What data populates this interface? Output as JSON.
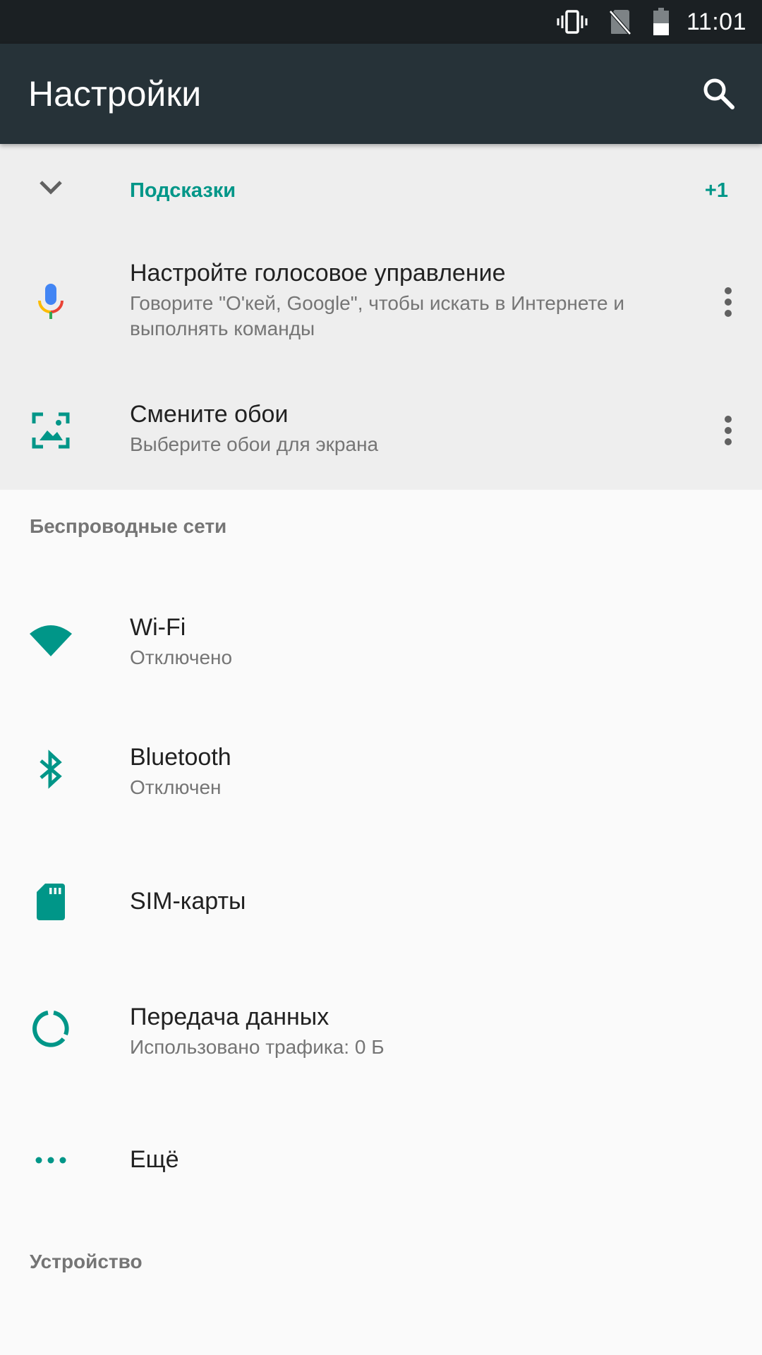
{
  "status_bar": {
    "time": "11:01"
  },
  "app_bar": {
    "title": "Настройки"
  },
  "suggestions": {
    "header": "Подсказки",
    "count": "+1",
    "items": [
      {
        "title": "Настройте голосовое управление",
        "subtitle": "Говорите \"О'кей, Google\", чтобы искать в Интернете и выполнять команды",
        "icon": "mic-icon"
      },
      {
        "title": "Смените обои",
        "subtitle": "Выберите обои для экрана",
        "icon": "wallpaper-icon"
      }
    ]
  },
  "sections": {
    "wireless": {
      "header": "Беспроводные сети",
      "items": [
        {
          "title": "Wi-Fi",
          "subtitle": "Отключено",
          "icon": "wifi-icon"
        },
        {
          "title": "Bluetooth",
          "subtitle": "Отключен",
          "icon": "bluetooth-icon"
        },
        {
          "title": "SIM-карты",
          "icon": "sim-card-icon"
        },
        {
          "title": "Передача данных",
          "subtitle": "Использовано трафика: 0 Б",
          "icon": "data-usage-icon"
        },
        {
          "title": "Ещё",
          "icon": "more-dots-icon"
        }
      ]
    },
    "device": {
      "header": "Устройство"
    }
  },
  "colors": {
    "accent": "#009688",
    "app_bar": "#263238",
    "status_bar": "#1b2023"
  }
}
